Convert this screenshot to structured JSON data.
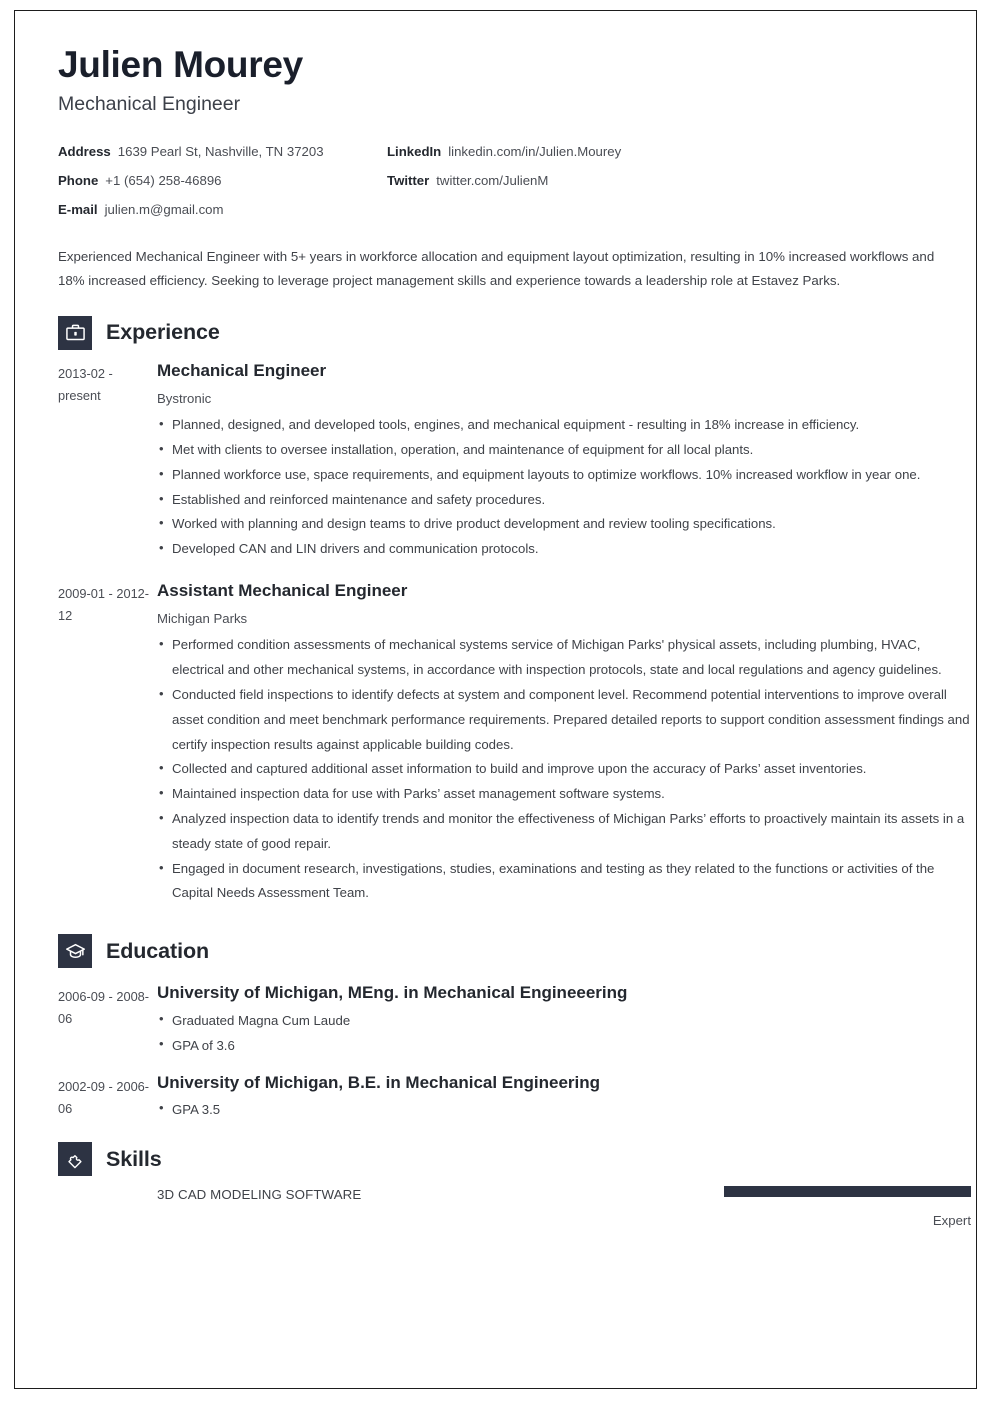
{
  "header": {
    "name": "Julien Mourey",
    "job_title": "Mechanical Engineer"
  },
  "contact": {
    "rows": [
      {
        "left": {
          "label": "Address",
          "value": "1639 Pearl St, Nashville, TN 37203"
        },
        "right": {
          "label": "LinkedIn",
          "value": "linkedin.com/in/Julien.Mourey"
        }
      },
      {
        "left": {
          "label": "Phone",
          "value": "+1 (654) 258-46896"
        },
        "right": {
          "label": "Twitter",
          "value": "twitter.com/JulienM"
        }
      },
      {
        "left": {
          "label": "E-mail",
          "value": "julien.m@gmail.com"
        },
        "right": {
          "label": "",
          "value": ""
        }
      }
    ]
  },
  "summary": "Experienced Mechanical Engineer with 5+ years in workforce allocation and equipment layout optimization, resulting in 10% increased workflows and 18% increased efficiency. Seeking to leverage project management skills and experience towards a leadership role at Estavez Parks.",
  "sections": {
    "experience": {
      "title": "Experience",
      "icon": "briefcase-icon",
      "entries": [
        {
          "dates": "2013-02 - present",
          "title": "Mechanical Engineer",
          "organization": "Bystronic",
          "bullets": [
            "Planned, designed, and developed tools, engines, and mechanical equipment - resulting in 18% increase in efficiency.",
            "Met with clients to oversee installation, operation, and maintenance of equipment for all local plants.",
            "Planned workforce use, space requirements, and equipment layouts to optimize workflows. 10% increased workflow in year one.",
            "Established and reinforced maintenance and safety procedures.",
            "Worked with planning and design teams to drive product development and review tooling specifications.",
            "Developed CAN and LIN drivers and communication protocols."
          ]
        },
        {
          "dates": "2009-01 - 2012-12",
          "title": "Assistant Mechanical Engineer",
          "organization": "Michigan Parks",
          "bullets": [
            "Performed condition assessments of mechanical systems service of Michigan Parks' physical assets, including plumbing, HVAC, electrical and other mechanical systems, in accordance with inspection protocols, state and local regulations and agency guidelines.",
            "Conducted field inspections to identify defects at system and component level. Recommend potential interventions to improve overall asset condition and meet benchmark performance requirements. Prepared detailed reports to support condition assessment findings and certify inspection results against applicable building codes.",
            "Collected and captured additional asset information to build and improve upon the accuracy of Parks’ asset inventories.",
            "Maintained inspection data for use with Parks’ asset management software systems.",
            "Analyzed inspection data to identify trends and monitor the effectiveness of Michigan Parks’ efforts to proactively maintain its assets in a steady state of good repair.",
            "Engaged in document research, investigations, studies, examinations and testing as they related to the functions or activities of the Capital Needs Assessment Team."
          ]
        }
      ]
    },
    "education": {
      "title": "Education",
      "icon": "graduation-cap-icon",
      "entries": [
        {
          "dates": "2006-09 - 2008-06",
          "title": "University of Michigan, MEng. in Mechanical Engineeering",
          "bullets": [
            "Graduated Magna Cum Laude",
            "GPA of 3.6"
          ]
        },
        {
          "dates": "2002-09 - 2006-06",
          "title": "University of Michigan, B.E. in Mechanical Engineering",
          "bullets": [
            "GPA 3.5"
          ]
        }
      ]
    },
    "skills": {
      "title": "Skills",
      "icon": "puzzle-piece-icon",
      "items": [
        {
          "name": "3D CAD MODELING SOFTWARE",
          "level_label": "Expert",
          "level_percent": 100
        }
      ]
    }
  },
  "colors": {
    "accent_dark": "#2d3343",
    "heading": "#24282f",
    "body_text": "#3f4248",
    "page_border": "#1d1d1d"
  }
}
